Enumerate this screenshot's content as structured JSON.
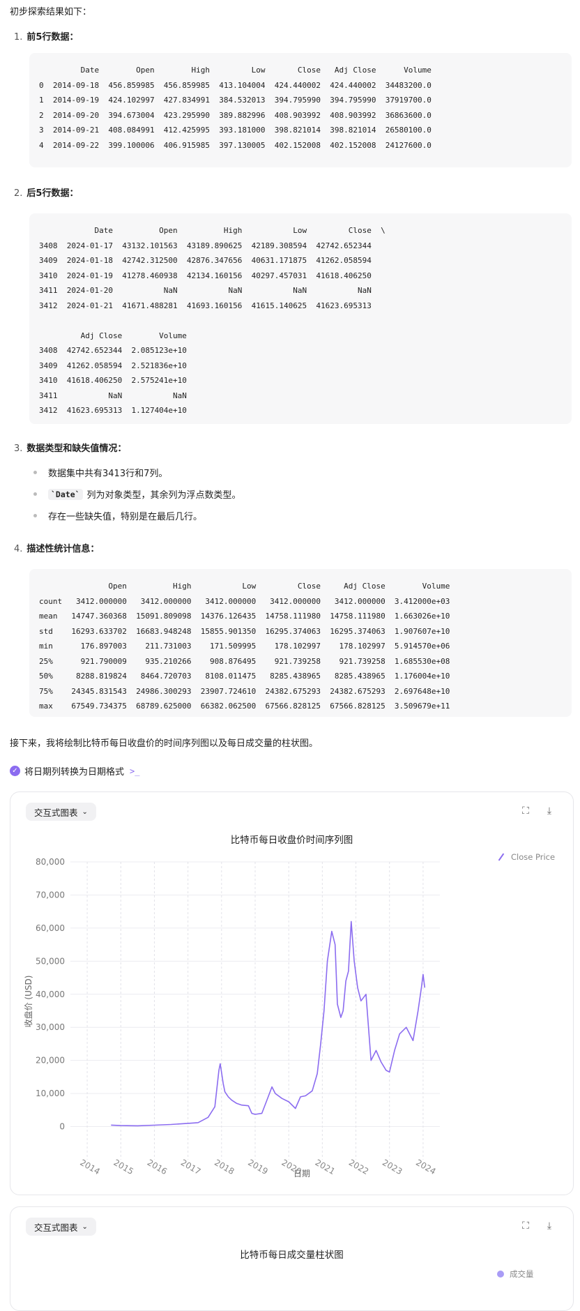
{
  "intro": "初步探索结果如下：",
  "sections": [
    {
      "num": "1.",
      "title": "前5行数据："
    },
    {
      "num": "2.",
      "title": "后5行数据："
    },
    {
      "num": "3.",
      "title": "数据类型和缺失值情况："
    },
    {
      "num": "4.",
      "title": "描述性统计信息："
    }
  ],
  "code_head": "         Date        Open        High         Low       Close   Adj Close      Volume\n0  2014-09-18  456.859985  456.859985  413.104004  424.440002  424.440002  34483200.0\n1  2014-09-19  424.102997  427.834991  384.532013  394.795990  394.795990  37919700.0\n2  2014-09-20  394.673004  423.295990  389.882996  408.903992  408.903992  36863600.0\n3  2014-09-21  408.084991  412.425995  393.181000  398.821014  398.821014  26580100.0\n4  2014-09-22  399.100006  406.915985  397.130005  402.152008  402.152008  24127600.0",
  "code_tail": "            Date          Open          High           Low         Close  \\\n3408  2024-01-17  43132.101563  43189.890625  42189.308594  42742.652344\n3409  2024-01-18  42742.312500  42876.347656  40631.171875  41262.058594\n3410  2024-01-19  41278.460938  42134.160156  40297.457031  41618.406250\n3411  2024-01-20           NaN           NaN           NaN           NaN\n3412  2024-01-21  41671.488281  41693.160156  41615.140625  41623.695313\n\n         Adj Close        Volume\n3408  42742.652344  2.085123e+10\n3409  41262.058594  2.521836e+10\n3410  41618.406250  2.575241e+10\n3411           NaN           NaN\n3412  41623.695313  1.127404e+10",
  "bullets": [
    {
      "code": "",
      "text": "数据集中共有3413行和7列。"
    },
    {
      "code": "`Date`",
      "text": "列为对象类型，其余列为浮点数类型。"
    },
    {
      "code": "",
      "text": "存在一些缺失值，特别是在最后几行。"
    }
  ],
  "code_stats": "               Open          High           Low         Close     Adj Close        Volume\ncount   3412.000000   3412.000000   3412.000000   3412.000000   3412.000000  3.412000e+03\nmean   14747.360368  15091.809098  14376.126435  14758.111980  14758.111980  1.663026e+10\nstd    16293.633702  16683.948248  15855.901350  16295.374063  16295.374063  1.907607e+10\nmin      176.897003    211.731003    171.509995    178.102997    178.102997  5.914570e+06\n25%      921.790009    935.210266    908.876495    921.739258    921.739258  1.685530e+08\n50%     8288.819824   8464.720703   8108.011475   8285.438965   8285.438965  1.176004e+10\n75%    24345.831543  24986.300293  23907.724610  24382.675293  24382.675293  2.697648e+10\nmax    67549.734375  68789.625000  66382.062500  67566.828125  67566.828125  3.509679e+11",
  "next_text": "接下来，我将绘制比特币每日收盘价的时间序列图以及每日成交量的柱状图。",
  "step_label": "将日期列转换为日期格式",
  "step_term": ">_",
  "card1": {
    "dropdown": "交互式图表",
    "chevron": "⌄",
    "fullscreen_glyph": "⛶",
    "download_glyph": "⤓",
    "title": "比特币每日收盘价时间序列图",
    "legend": "Close Price",
    "ylabel": "收盘价 (USD)",
    "xlabel": "日期"
  },
  "card2": {
    "dropdown": "交互式图表",
    "chevron": "⌄",
    "fullscreen_glyph": "⛶",
    "download_glyph": "⤓",
    "title": "比特币每日成交量柱状图",
    "legend": "成交量"
  },
  "accent_color": "#8b6cf0",
  "chart_data": {
    "type": "line",
    "title": "比特币每日收盘价时间序列图",
    "xlabel": "日期",
    "ylabel": "收盘价 (USD)",
    "ylim": [
      -10000,
      80000
    ],
    "yticks": [
      0,
      10000,
      20000,
      30000,
      40000,
      50000,
      60000,
      70000,
      80000
    ],
    "ytick_labels": [
      "0",
      "10,000",
      "20,000",
      "30,000",
      "40,000",
      "50,000",
      "60,000",
      "70,000",
      "80,000"
    ],
    "xlim": [
      2013.5,
      2024.5
    ],
    "xticks": [
      2014,
      2015,
      2016,
      2017,
      2018,
      2019,
      2020,
      2021,
      2022,
      2023,
      2024
    ],
    "xtick_labels": [
      "2014",
      "2015",
      "2016",
      "2017",
      "2018",
      "2019",
      "2020",
      "2021",
      "2022",
      "2023",
      "2024"
    ],
    "legend_position": "top-right",
    "grid": true,
    "series": [
      {
        "name": "Close Price",
        "color": "#8b6cf0",
        "x": [
          2014.71,
          2015.0,
          2015.5,
          2016.0,
          2016.5,
          2017.0,
          2017.3,
          2017.6,
          2017.8,
          2017.92,
          2017.96,
          2018.05,
          2018.1,
          2018.2,
          2018.3,
          2018.45,
          2018.6,
          2018.8,
          2018.9,
          2019.0,
          2019.2,
          2019.35,
          2019.5,
          2019.6,
          2019.8,
          2020.0,
          2020.2,
          2020.35,
          2020.5,
          2020.7,
          2020.85,
          2020.95,
          2021.05,
          2021.15,
          2021.28,
          2021.38,
          2021.45,
          2021.55,
          2021.62,
          2021.7,
          2021.78,
          2021.86,
          2021.95,
          2022.05,
          2022.15,
          2022.3,
          2022.45,
          2022.6,
          2022.75,
          2022.9,
          2023.0,
          2023.15,
          2023.3,
          2023.5,
          2023.7,
          2023.85,
          2023.95,
          2024.0,
          2024.05
        ],
        "y": [
          450,
          300,
          250,
          430,
          650,
          990,
          1200,
          2800,
          6000,
          17000,
          19000,
          13000,
          10500,
          9000,
          8000,
          7000,
          6500,
          6300,
          4000,
          3700,
          4000,
          8000,
          12000,
          10000,
          8500,
          7500,
          5500,
          9000,
          9300,
          10800,
          16000,
          25000,
          35000,
          50000,
          59000,
          55000,
          37000,
          33000,
          35000,
          44000,
          47000,
          62000,
          50000,
          42000,
          38000,
          40000,
          20000,
          23000,
          19500,
          17000,
          16500,
          23000,
          28000,
          30000,
          26000,
          35000,
          42000,
          46000,
          42000
        ]
      }
    ]
  }
}
